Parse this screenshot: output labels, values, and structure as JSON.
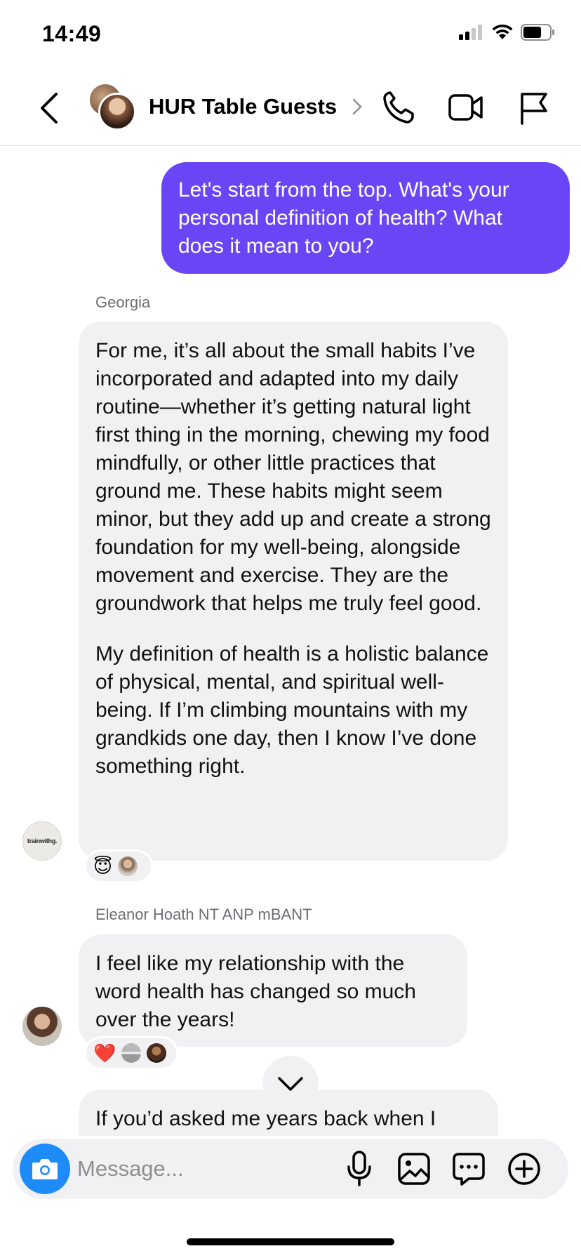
{
  "status": {
    "time": "14:49"
  },
  "header": {
    "title": "HUR Table Guests",
    "icons": [
      "back-chevron-icon",
      "chevron-right-icon",
      "phone-icon",
      "video-icon",
      "flag-icon"
    ]
  },
  "messages": [
    {
      "direction": "outgoing",
      "text": "Let's start from the top. What's your personal definition of health? What does it mean to you?"
    },
    {
      "direction": "incoming",
      "sender": "Georgia",
      "avatar_label": "trainwithg.",
      "paragraphs": [
        "For me, it’s all about the small habits I’ve incorporated and adapted into my daily routine—whether it’s getting natural light first thing in the morning, chewing my food mindfully, or other little practices that ground me. These habits might seem minor, but they add up and create a strong foundation for my well-being, alongside movement and exercise. They are the groundwork that helps me truly feel good.",
        "My definition of health is a holistic balance of physical, mental, and spiritual well-being. If I’m climbing mountains with my grandkids one day, then I know I’ve done something right."
      ],
      "reactions": [
        "😇"
      ]
    },
    {
      "direction": "incoming",
      "sender": "Eleanor Hoath NT ANP mBANT",
      "text": "I feel like my relationship with the word health has changed so much over the years!",
      "reactions": [
        "❤️"
      ]
    },
    {
      "direction": "incoming",
      "text": "If you’d asked me years back when I"
    }
  ],
  "composer": {
    "placeholder": "Message...",
    "icons": [
      "camera-icon",
      "microphone-icon",
      "gallery-icon",
      "sticker-icon",
      "add-icon"
    ]
  },
  "colors": {
    "outgoing_bubble": "#6a45f5",
    "incoming_bubble": "#f1f1f3",
    "camera_button": "#1d8cf8"
  }
}
